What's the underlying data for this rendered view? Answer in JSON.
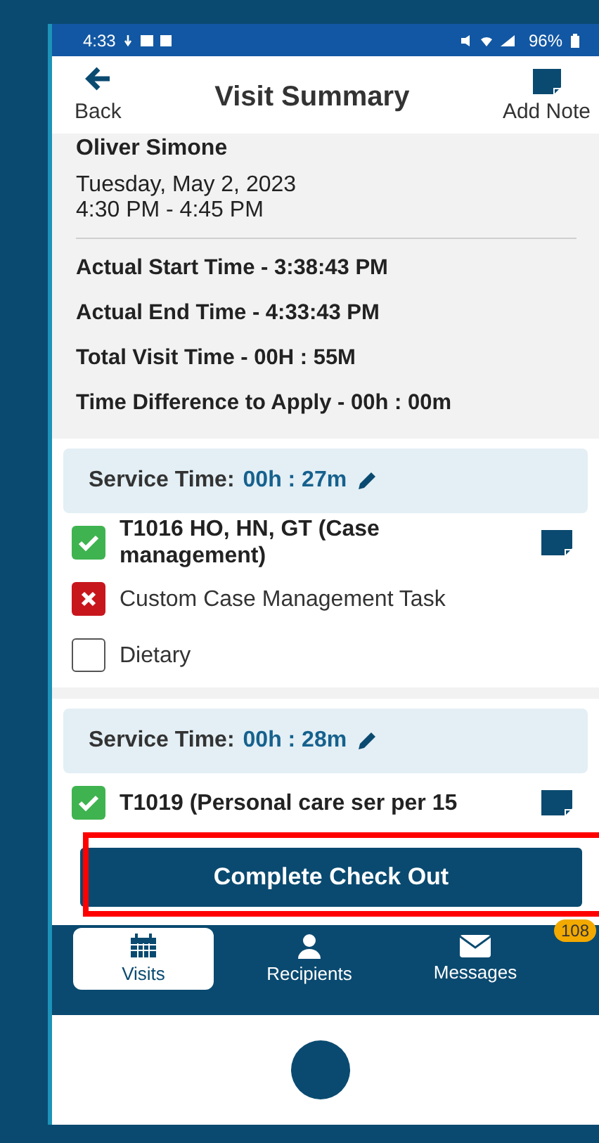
{
  "status_bar": {
    "time": "4:33",
    "battery": "96%"
  },
  "header": {
    "back_label": "Back",
    "title": "Visit Summary",
    "note_label": "Add Note"
  },
  "visit": {
    "recipient": "Oliver Simone",
    "date": "Tuesday, May 2, 2023",
    "time_range": "4:30 PM - 4:45 PM"
  },
  "summary_lines": [
    "Actual Start Time - 3:38:43 PM",
    "Actual End Time - 4:33:43 PM",
    "Total Visit Time - 00H : 55M",
    "Time Difference to Apply - 00h : 00m"
  ],
  "services": [
    {
      "label": "Service Time:",
      "value": "00h : 27m",
      "tasks": [
        {
          "kind": "done",
          "text": "T1016 HO, HN, GT (Case management)",
          "has_note": true
        },
        {
          "kind": "failed",
          "text": "Custom Case Management Task",
          "has_note": false
        },
        {
          "kind": "empty",
          "text": "Dietary",
          "has_note": false
        }
      ]
    },
    {
      "label": "Service Time:",
      "value": "00h : 28m",
      "tasks": [
        {
          "kind": "done",
          "text": "T1019  (Personal care ser per 15",
          "has_note": true
        }
      ]
    }
  ],
  "action_button": "Complete Check Out",
  "nav": [
    {
      "label": "Visits",
      "selected": true,
      "kind": "calendar"
    },
    {
      "label": "Recipients",
      "selected": false,
      "kind": "person"
    },
    {
      "label": "Messages",
      "selected": false,
      "kind": "mail",
      "badge": "108"
    }
  ]
}
